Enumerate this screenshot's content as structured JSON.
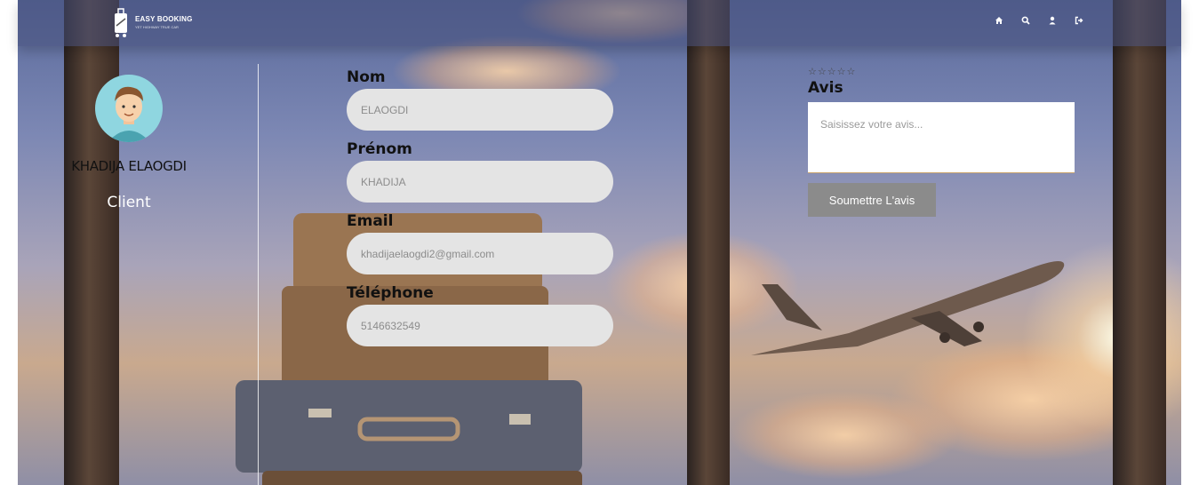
{
  "brand": {
    "name": "EASY BOOKING",
    "tagline": "YET HIGHWAY TRUE CAR"
  },
  "nav": {
    "items": [
      {
        "icon": "home-icon"
      },
      {
        "icon": "search-icon"
      },
      {
        "icon": "user-icon"
      },
      {
        "icon": "logout-icon"
      }
    ]
  },
  "profile": {
    "name": "KHADIJA ELAOGDI",
    "role": "Client"
  },
  "form": {
    "nom_label": "Nom",
    "nom_value": "ELAOGDI",
    "prenom_label": "Prénom",
    "prenom_value": "KHADIJA",
    "email_label": "Email",
    "email_value": "khadijaelaogdi2@gmail.com",
    "telephone_label": "Téléphone",
    "telephone_value": "5146632549"
  },
  "review": {
    "stars": "☆☆☆☆☆",
    "title": "Avis",
    "placeholder": "Saisissez votre avis...",
    "submit_label": "Soumettre L'avis"
  },
  "colors": {
    "accent": "#8b8b8b",
    "input_bg": "#e4e4e4"
  }
}
